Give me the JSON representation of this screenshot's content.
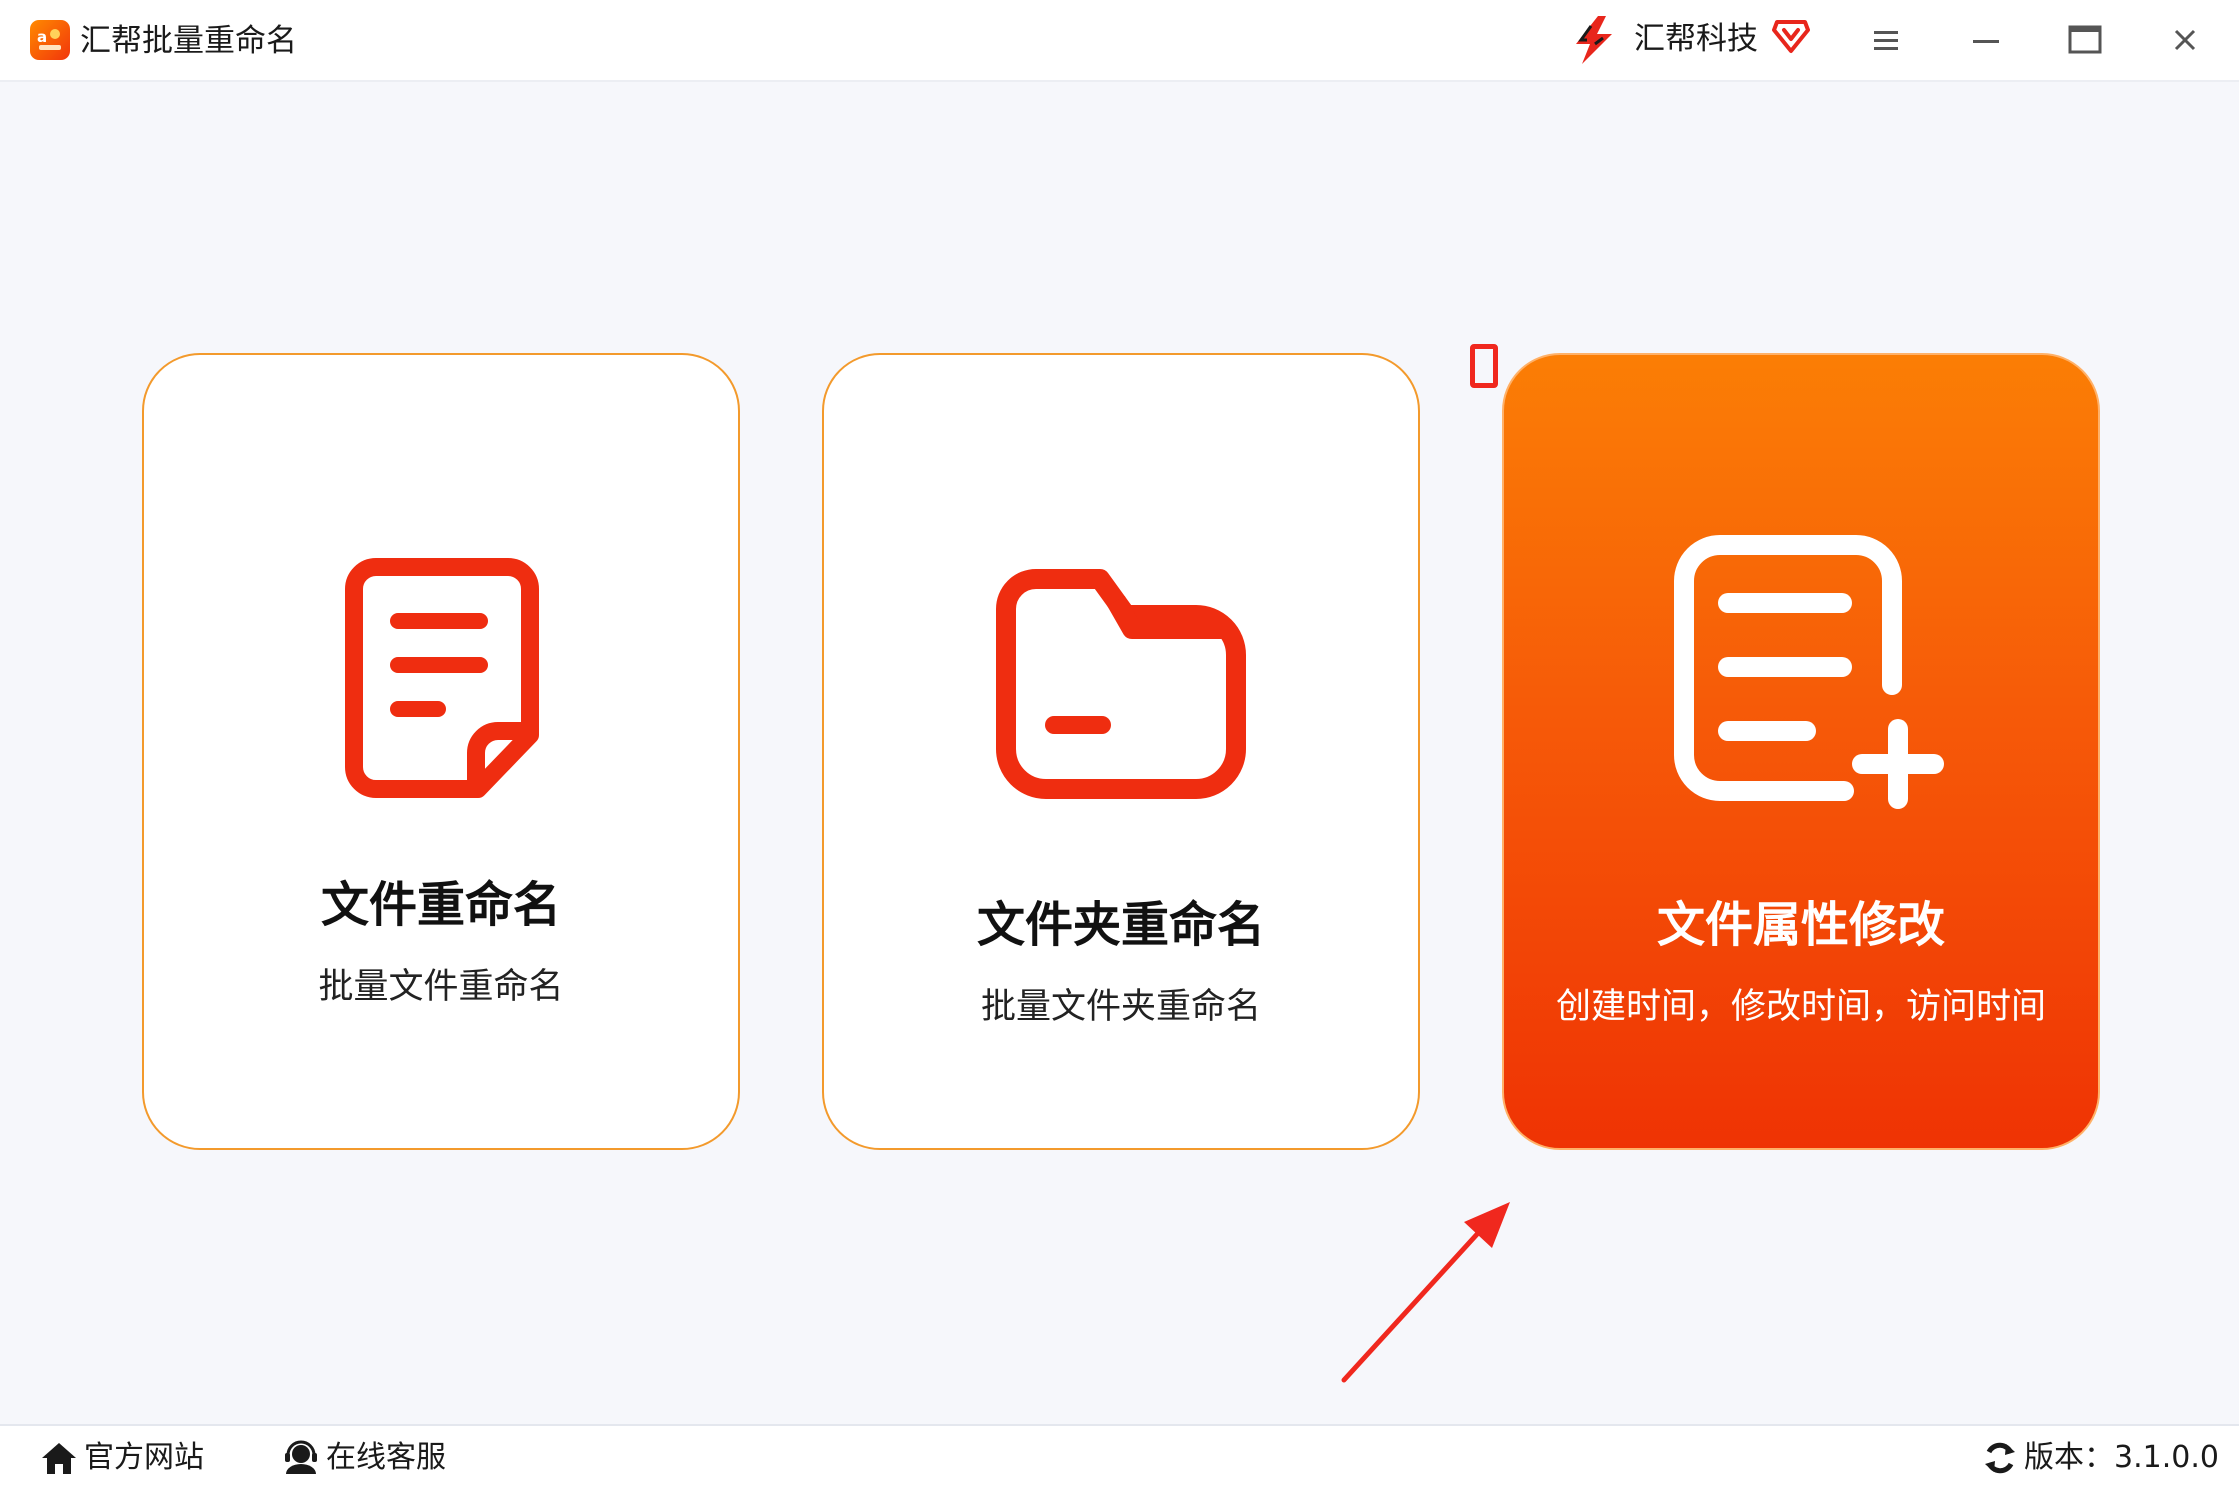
{
  "window": {
    "title": "汇帮批量重命名",
    "brand_name": "汇帮科技"
  },
  "cards": [
    {
      "title": "文件重命名",
      "subtitle": "批量文件重命名",
      "icon": "document-icon",
      "active": false
    },
    {
      "title": "文件夹重命名",
      "subtitle": "批量文件夹重命名",
      "icon": "folder-icon",
      "active": false
    },
    {
      "title": "文件属性修改",
      "subtitle": "创建时间，修改时间，访问时间",
      "icon": "document-add-icon",
      "active": true
    }
  ],
  "footer": {
    "official_site": "官方网站",
    "online_service": "在线客服",
    "version": "版本：3.1.0.0"
  },
  "colors": {
    "accent_orange": "#fb7e05",
    "accent_red": "#ef3304",
    "icon_red": "#ef2d10",
    "card_border": "#f39a2c",
    "background": "#f6f7fb"
  }
}
